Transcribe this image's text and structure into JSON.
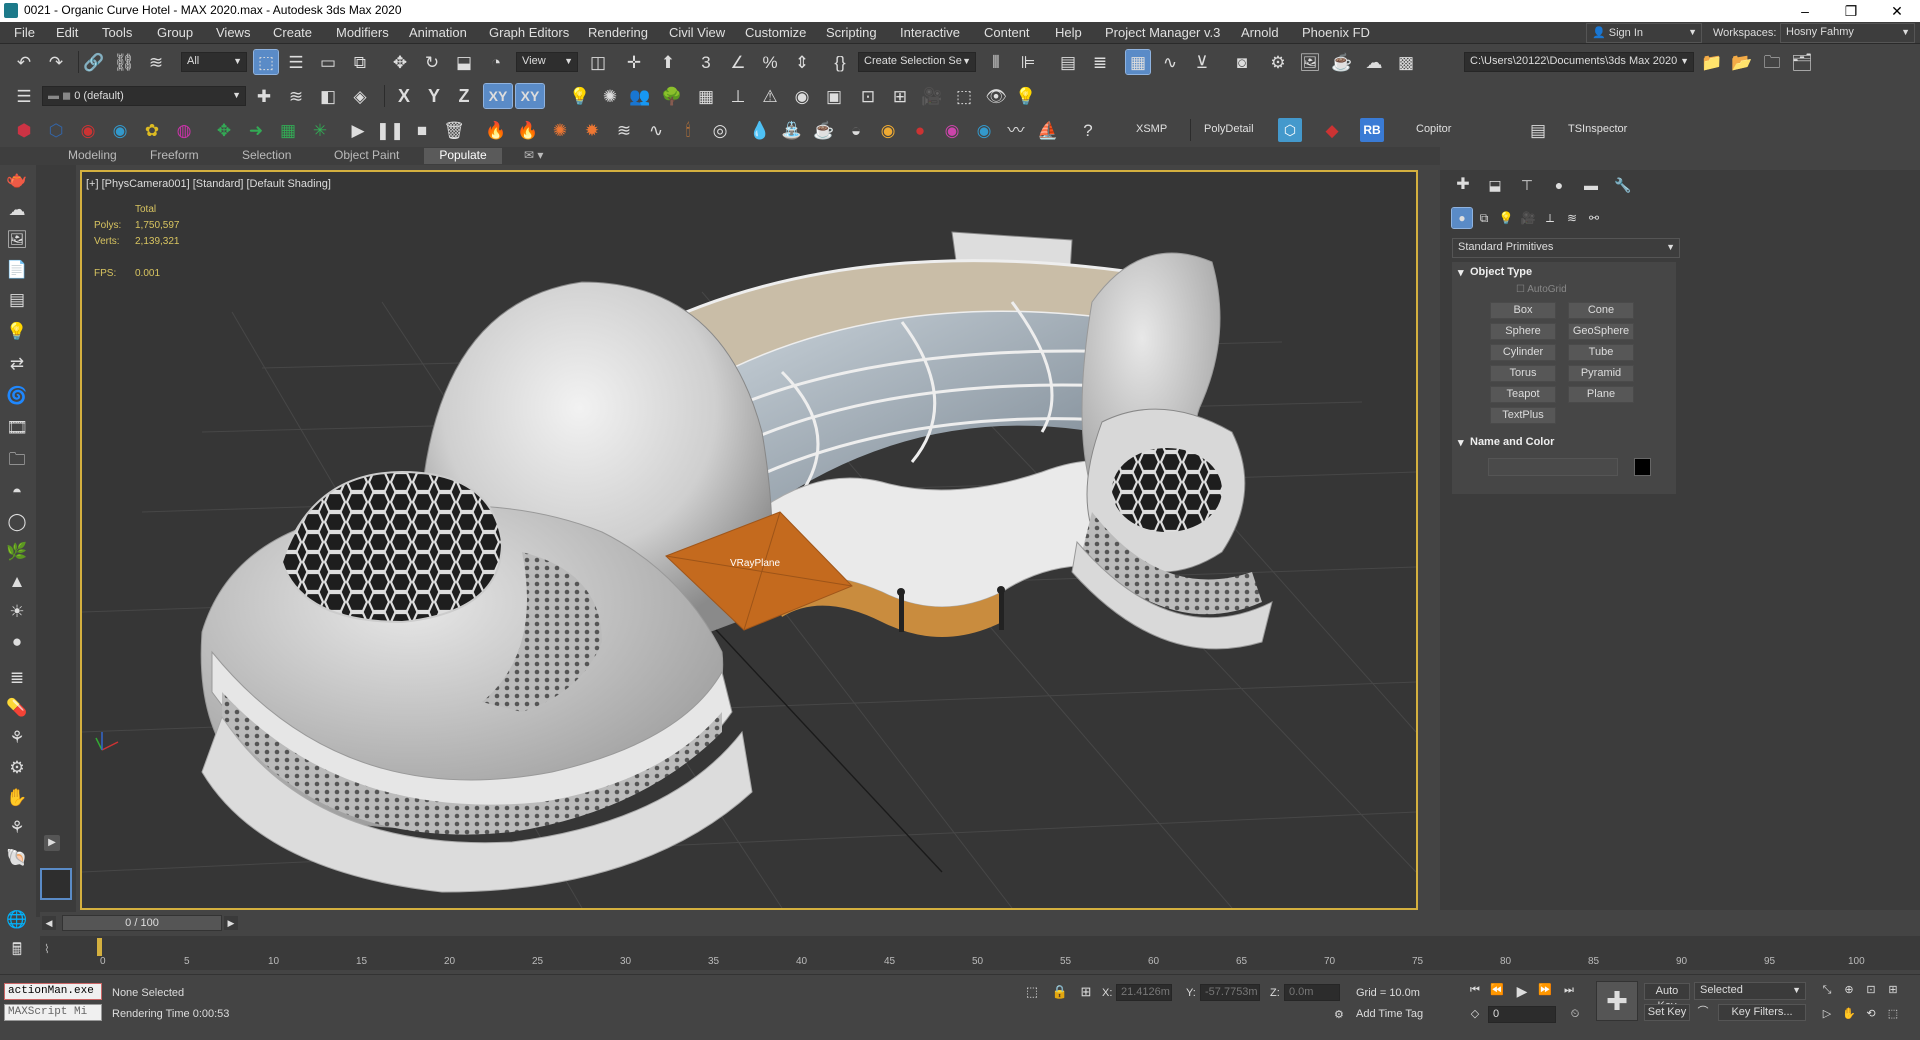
{
  "window": {
    "title": "0021 - Organic Curve Hotel - MAX 2020.max - Autodesk 3ds Max 2020"
  },
  "menubar": {
    "items": [
      "File",
      "Edit",
      "Tools",
      "Group",
      "Views",
      "Create",
      "Modifiers",
      "Animation",
      "Graph Editors",
      "Rendering",
      "Civil View",
      "Customize",
      "Scripting",
      "Interactive",
      "Content",
      "Help",
      "Project Manager v.3",
      "Arnold",
      "Phoenix FD"
    ]
  },
  "account": {
    "sign_in": "Sign In",
    "workspaces_label": "Workspaces:",
    "workspace": "Hosny Fahmy"
  },
  "toolbar1": {
    "filter": "All",
    "ref_coord": "View",
    "selection_set": "Create Selection Se",
    "project_path": "C:\\Users\\20122\\Documents\\3ds Max 2020"
  },
  "toolbar2": {
    "layer": "0 (default)",
    "axis_x": "X",
    "axis_y": "Y",
    "axis_z": "Z",
    "axis_xy": "XY",
    "axis_xy2": "XY"
  },
  "toolbar3": {
    "xsmp": "XSMP",
    "polydetail": "PolyDetail",
    "rb": "RB",
    "copitor": "Copitor",
    "tsinspector": "TSInspector"
  },
  "ribbon": {
    "tabs": [
      "Modeling",
      "Freeform",
      "Selection",
      "Object Paint",
      "Populate"
    ],
    "active": "Populate"
  },
  "viewport": {
    "label": "[+] [PhysCamera001] [Standard] [Default Shading]",
    "stats": {
      "total_label": "Total",
      "polys_label": "Polys:",
      "polys": "1,750,597",
      "verts_label": "Verts:",
      "verts": "2,139,321",
      "fps_label": "FPS:",
      "fps": "0.001"
    },
    "plane_label": "VRayPlane"
  },
  "cmdpanel": {
    "category": "Standard Primitives",
    "object_type": "Object Type",
    "autogrid": "AutoGrid",
    "buttons": [
      "Box",
      "Cone",
      "Sphere",
      "GeoSphere",
      "Cylinder",
      "Tube",
      "Torus",
      "Pyramid",
      "Teapot",
      "Plane",
      "TextPlus"
    ],
    "name_and_color": "Name and Color",
    "color": "#000000"
  },
  "timeline": {
    "frame_display": "0 / 100",
    "ticks": [
      "0",
      "5",
      "10",
      "15",
      "20",
      "25",
      "30",
      "35",
      "40",
      "45",
      "50",
      "55",
      "60",
      "65",
      "70",
      "75",
      "80",
      "85",
      "90",
      "95",
      "100"
    ]
  },
  "statusbar": {
    "script1": "actionMan.exe",
    "script2": "MAXScript Mi",
    "selection_status": "None Selected",
    "render_time": "Rendering Time 0:00:53",
    "x_label": "X:",
    "x": "21.4126m",
    "y_label": "Y:",
    "y": "-57.7753m",
    "z_label": "Z:",
    "z": "0.0m",
    "grid": "Grid = 10.0m",
    "add_time_tag": "Add Time Tag",
    "auto_key": "Auto Key",
    "selected": "Selected",
    "set_key": "Set Key",
    "key_filters": "Key Filters...",
    "frame": "0"
  }
}
